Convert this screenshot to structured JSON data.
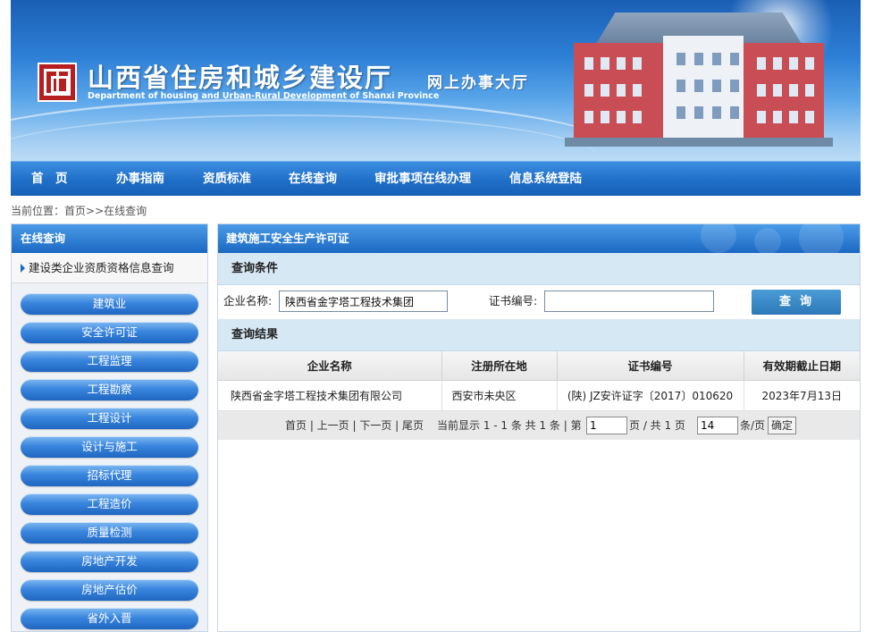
{
  "banner": {
    "title_cn": "山西省住房和城乡建设厅",
    "title_en": "Department of housing and Urban-Rural Development of Shanxi Province",
    "hall": "网上办事大厅"
  },
  "nav": [
    "首　页",
    "办事指南",
    "资质标准",
    "在线查询",
    "审批事项在线办理",
    "信息系统登陆"
  ],
  "breadcrumb": {
    "prefix": "当前位置：",
    "home": "首页",
    "sep": ">>",
    "current": "在线查询"
  },
  "sidebar": {
    "header": "在线查询",
    "sub": "建设类企业资质资格信息查询",
    "items": [
      "建筑业",
      "安全许可证",
      "工程监理",
      "工程勘察",
      "工程设计",
      "设计与施工",
      "招标代理",
      "工程造价",
      "质量检测",
      "房地产开发",
      "房地产估价",
      "省外入晋"
    ]
  },
  "main": {
    "header": "建筑施工安全生产许可证",
    "conditions_title": "查询条件",
    "company_label": "企业名称:",
    "company_value": "陕西省金字塔工程技术集团",
    "cert_label": "证书编号:",
    "cert_value": "",
    "search_label": "查询",
    "results_title": "查询结果",
    "columns": [
      "企业名称",
      "注册所在地",
      "证书编号",
      "有效期截止日期"
    ],
    "rows": [
      [
        "陕西省金字塔工程技术集团有限公司",
        "西安市未央区",
        "(陕) JZ安许证字〔2017〕010620",
        "2023年7月13日"
      ]
    ],
    "pager": {
      "links": "首页 | 上一页 | 下一页 | 尾页",
      "display": "当前显示 1 - 1 条  共 1 条 | 第",
      "page_value": "1",
      "of_pages": "页 / 共 1 页",
      "per_page_value": "14",
      "per_page_suffix": "条/页",
      "confirm": "确定"
    }
  },
  "colors": {
    "nav_blue": "#1f6fc8",
    "section_bg": "#d7e8f5",
    "logo_red": "#b61f1f"
  }
}
